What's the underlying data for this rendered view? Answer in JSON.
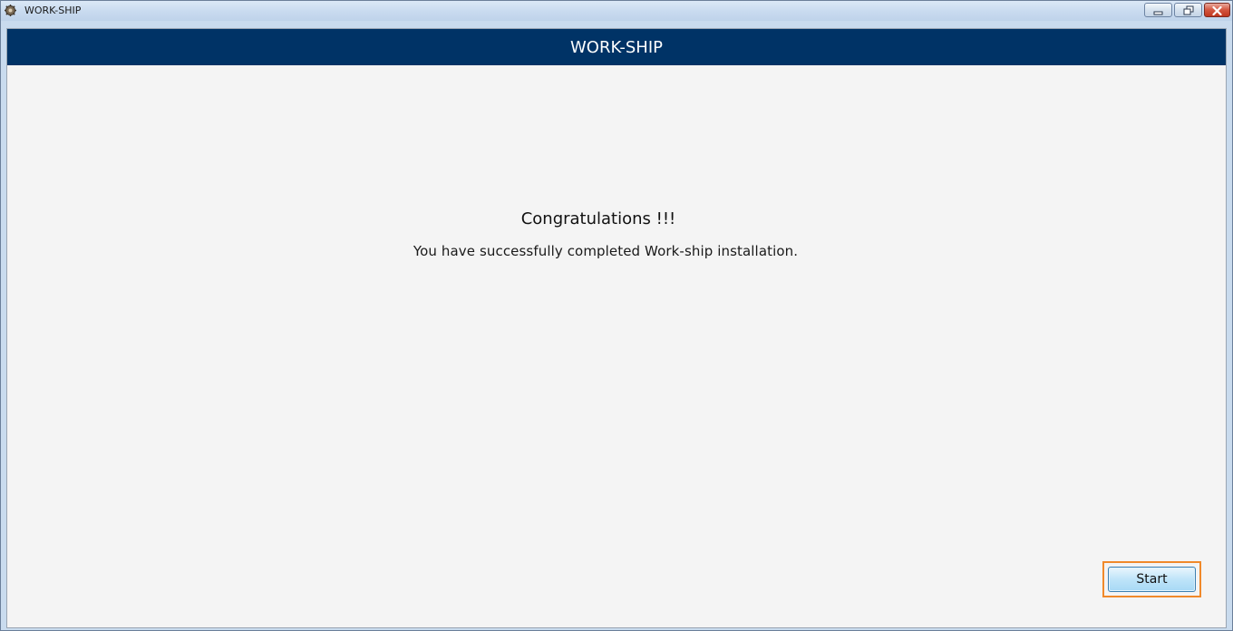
{
  "window": {
    "title": "WORK-SHIP",
    "icon": "app-icon",
    "controls": {
      "minimize_icon": "minimize-icon",
      "restore_icon": "restore-icon",
      "close_icon": "close-icon"
    }
  },
  "header": {
    "title": "WORK-SHIP"
  },
  "main": {
    "heading": "Congratulations !!!",
    "message": "You have successfully completed Work-ship installation."
  },
  "footer": {
    "start_label": "Start"
  },
  "colors": {
    "banner": "#003366",
    "highlight": "#f0892a",
    "button_border": "#3c7fb1"
  }
}
